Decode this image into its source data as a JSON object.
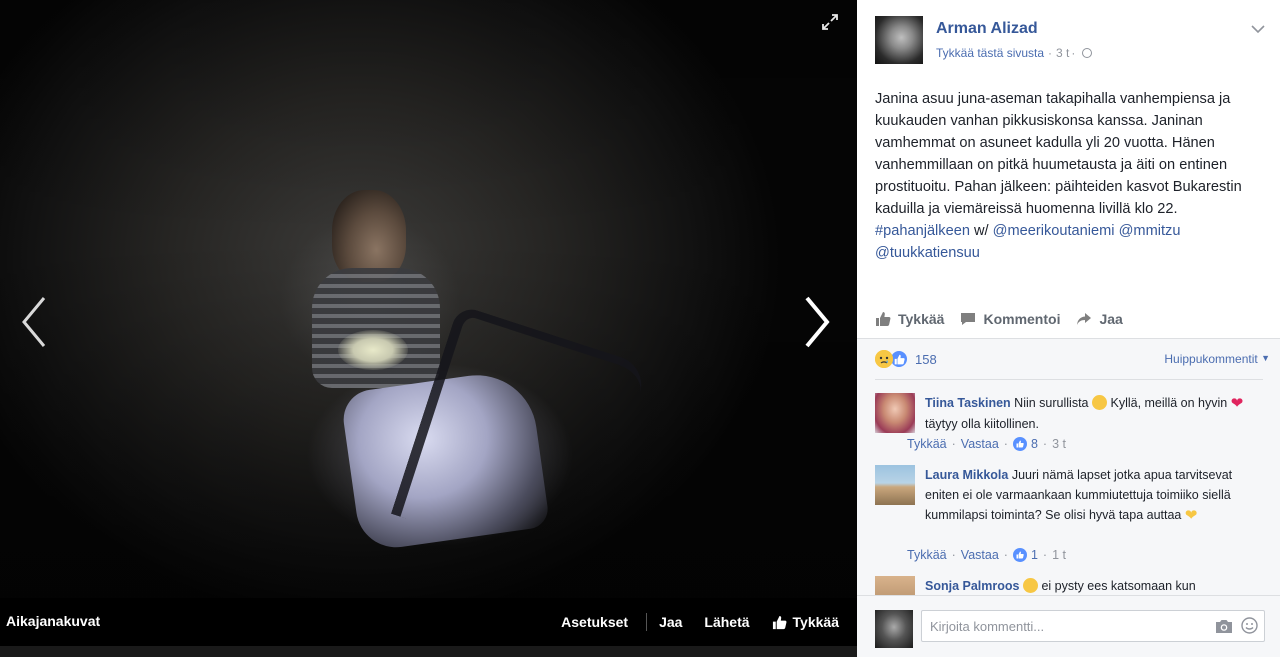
{
  "viewer": {
    "album_title": "Aikajanakuvat",
    "actions": {
      "settings": "Asetukset",
      "share": "Jaa",
      "send": "Lähetä",
      "like": "Tykkää"
    }
  },
  "post": {
    "author": "Arman Alizad",
    "like_page": "Tykkää tästä sivusta",
    "time": "3 t",
    "text_before": "Janina asuu juna-aseman takapihalla vanhempiensa ja kuukauden vanhan pikkusiskonsa kanssa. Janinan vamhemmat on asuneet kadulla yli 20 vuotta. Hänen vanhemmillaan on pitkä huumetausta ja äiti on entinen prostituoitu. Pahan jälkeen: päihteiden kasvot Bukarestin kaduilla ja viemäreissä huomenna livillä klo 22. ",
    "hashtag": "#pahanjälkeen",
    "text_w": " w/ ",
    "mention_1": "@meerikoutaniemi",
    "mention_2": "@mmitzu",
    "mention_3": "@tuukkatiensuu"
  },
  "post_actions": {
    "like": "Tykkää",
    "comment": "Kommentoi",
    "share": "Jaa"
  },
  "reactions": {
    "count": "158",
    "sort_label": "Huippukommentit"
  },
  "comments": [
    {
      "name": "Tiina Taskinen",
      "text_1": "Niin surullista",
      "text_2": "Kyllä, meillä on hyvin",
      "text_3": "täytyy olla kiitollinen.",
      "like": "Tykkää",
      "reply": "Vastaa",
      "likes": "8",
      "time": "3 t"
    },
    {
      "name": "Laura Mikkola",
      "text_1": "Juuri nämä lapset jotka apua tarvitsevat eniten ei ole varmaankaan kummiutettuja toimiiko siellä kummilapsi toiminta? Se olisi hyvä tapa auttaa",
      "like": "Tykkää",
      "reply": "Vastaa",
      "likes": "1",
      "time": "1 t"
    },
    {
      "name": "Sonja Palmroos",
      "text_1": "ei pysty ees katsomaan kun"
    }
  ],
  "reply": {
    "placeholder": "Kirjoita kommentti..."
  },
  "colors": {
    "link": "#365899",
    "like_blue": "#5890ff",
    "emoji_yellow": "#f7c744"
  }
}
